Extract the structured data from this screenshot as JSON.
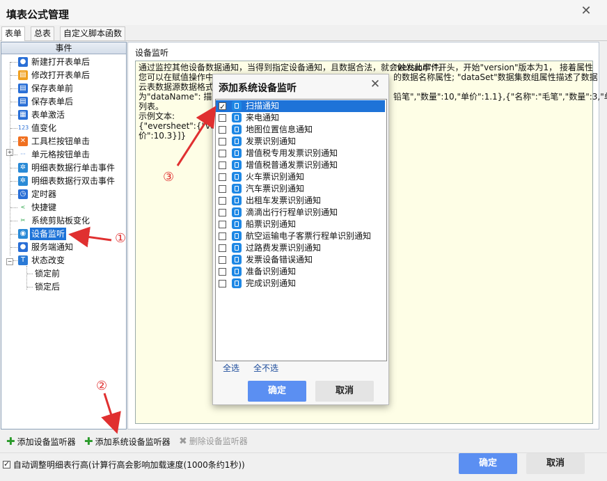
{
  "window": {
    "title": "填表公式管理",
    "close_glyph": "✕"
  },
  "tabs": [
    {
      "label": "表单"
    },
    {
      "label": "总表"
    },
    {
      "label": "自定义脚本函数"
    }
  ],
  "events_panel": {
    "header": "事件",
    "items": [
      {
        "label": "新建打开表单后",
        "icon": "user-icon"
      },
      {
        "label": "修改打开表单后",
        "icon": "folder-open-icon"
      },
      {
        "label": "保存表单前",
        "icon": "document-icon"
      },
      {
        "label": "保存表单后",
        "icon": "document-icon"
      },
      {
        "label": "表单激活",
        "icon": "form-activate-icon"
      },
      {
        "label": "值变化",
        "icon": "number-123-icon"
      },
      {
        "label": "工具栏按钮单击",
        "icon": "tools-icon"
      },
      {
        "label": "单元格按钮单击",
        "icon": "cell-button-icon"
      },
      {
        "label": "明细表数据行单击事件",
        "icon": "gear-icon"
      },
      {
        "label": "明细表数据行双击事件",
        "icon": "gear-icon"
      },
      {
        "label": "定时器",
        "icon": "timer-icon"
      },
      {
        "label": "快捷键",
        "icon": "share-icon"
      },
      {
        "label": "系统剪贴板变化",
        "icon": "scissors-icon"
      },
      {
        "label": "设备监听",
        "icon": "device-icon"
      },
      {
        "label": "服务端通知",
        "icon": "users-icon"
      },
      {
        "label": "状态改变",
        "icon": "text-t-icon"
      },
      {
        "label": "锁定前",
        "icon": ""
      },
      {
        "label": "锁定后",
        "icon": ""
      }
    ],
    "selected": "设备监听"
  },
  "detail": {
    "caption": "设备监听",
    "lines": [
      "通过监控其他设备数据通知，当得到指定设备通知，且数据合法，就会触发此事件。",
      "您可以在赋值操作中",
      "云表数据源数据格式",
      "为\"dataName\": 描述",
      "列表。",
      "示例文本:",
      "{\"eversheet\":{\"vers",
      "价\":10.3}]}"
    ],
    "frag_right_1": "\"version\":\"开头，开始\"version\"版本为1， 接着属性",
    "frag_right_2": "的数据名称属性; \"dataSet\"数据集数组属性描述了数据",
    "frag_right_3": "铅笔\",\"数量\":10,\"单价\":1.1},{\"名称\":\"毛笔\",\"数量\":3,\"单"
  },
  "dialog": {
    "title": "添加系统设备监听",
    "close_glyph": "✕",
    "items": [
      {
        "label": "扫描通知",
        "checked": true
      },
      {
        "label": "来电通知",
        "checked": false
      },
      {
        "label": "地图位置信息通知",
        "checked": false
      },
      {
        "label": "发票识别通知",
        "checked": false
      },
      {
        "label": "增值税专用发票识别通知",
        "checked": false
      },
      {
        "label": "增值税普通发票识别通知",
        "checked": false
      },
      {
        "label": "火车票识别通知",
        "checked": false
      },
      {
        "label": "汽车票识别通知",
        "checked": false
      },
      {
        "label": "出租车发票识别通知",
        "checked": false
      },
      {
        "label": "滴滴出行行程单识别通知",
        "checked": false
      },
      {
        "label": "船票识别通知",
        "checked": false
      },
      {
        "label": "航空运输电子客票行程单识别通知",
        "checked": false
      },
      {
        "label": "过路费发票识别通知",
        "checked": false
      },
      {
        "label": "发票设备错误通知",
        "checked": false
      },
      {
        "label": "准备识别通知",
        "checked": false
      },
      {
        "label": "完成识别通知",
        "checked": false
      }
    ],
    "select_all": "全选",
    "select_none": "全不选",
    "ok": "确定",
    "cancel": "取消"
  },
  "toolbar": {
    "add_listener": "添加设备监听器",
    "add_system_listener": "添加系统设备监听器",
    "delete_listener": "删除设备监听器"
  },
  "footer": {
    "auto_adjust_label": "自动调整明细表行高(计算行高会影响加载速度(1000条约1秒))",
    "auto_adjust_checked": true,
    "ok": "确定",
    "cancel": "取消"
  },
  "annotations": {
    "one": "①",
    "two": "②",
    "three": "③"
  },
  "colors": {
    "selection": "#1e73d8",
    "primary_button": "#5b8ff2",
    "annotation": "#e03030",
    "description_bg": "#fefee6"
  }
}
